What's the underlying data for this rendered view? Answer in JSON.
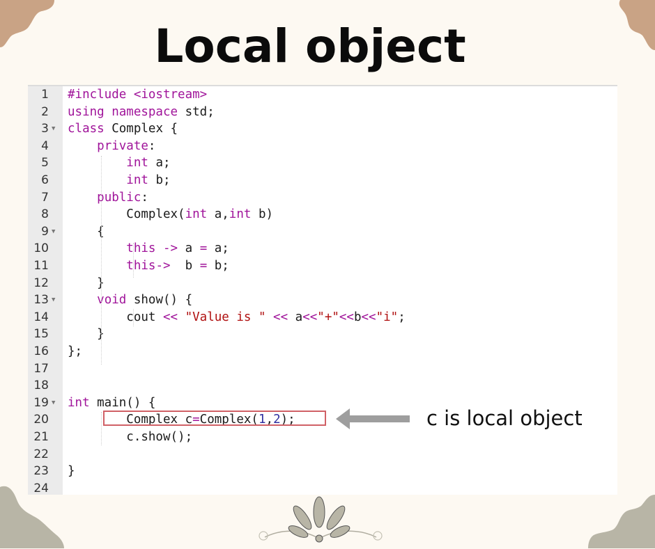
{
  "title": "Local object",
  "colors": {
    "background": "#fdf9f2",
    "corner_top": "#c9a385",
    "corner_bottom": "#b8b5a6",
    "keyword": "#a0149a",
    "string": "#b01010",
    "number": "#3030a0",
    "highlight_border": "#d06066",
    "arrow": "#9e9e9e"
  },
  "editor": {
    "lines": [
      {
        "num": "1",
        "fold": false
      },
      {
        "num": "2",
        "fold": false
      },
      {
        "num": "3",
        "fold": true
      },
      {
        "num": "4",
        "fold": false
      },
      {
        "num": "5",
        "fold": false
      },
      {
        "num": "6",
        "fold": false
      },
      {
        "num": "7",
        "fold": false
      },
      {
        "num": "8",
        "fold": false
      },
      {
        "num": "9",
        "fold": true
      },
      {
        "num": "10",
        "fold": false
      },
      {
        "num": "11",
        "fold": false
      },
      {
        "num": "12",
        "fold": false
      },
      {
        "num": "13",
        "fold": true
      },
      {
        "num": "14",
        "fold": false
      },
      {
        "num": "15",
        "fold": false
      },
      {
        "num": "16",
        "fold": false
      },
      {
        "num": "17",
        "fold": false
      },
      {
        "num": "18",
        "fold": false
      },
      {
        "num": "19",
        "fold": true
      },
      {
        "num": "20",
        "fold": false
      },
      {
        "num": "21",
        "fold": false
      },
      {
        "num": "22",
        "fold": false
      },
      {
        "num": "23",
        "fold": false
      },
      {
        "num": "24",
        "fold": false
      }
    ],
    "code": [
      [
        [
          "kw",
          "#include <iostream>"
        ]
      ],
      [
        [
          "kw",
          "using namespace"
        ],
        [
          "t",
          " std;"
        ]
      ],
      [
        [
          "kw",
          "class"
        ],
        [
          "t",
          " Complex {"
        ]
      ],
      [
        [
          "t",
          "    "
        ],
        [
          "kw",
          "private"
        ],
        [
          "t",
          ":"
        ]
      ],
      [
        [
          "t",
          "        "
        ],
        [
          "kw",
          "int"
        ],
        [
          "t",
          " a;"
        ]
      ],
      [
        [
          "t",
          "        "
        ],
        [
          "kw",
          "int"
        ],
        [
          "t",
          " b;"
        ]
      ],
      [
        [
          "t",
          "    "
        ],
        [
          "kw",
          "public"
        ],
        [
          "t",
          ":"
        ]
      ],
      [
        [
          "t",
          "        Complex("
        ],
        [
          "kw",
          "int"
        ],
        [
          "t",
          " a,"
        ],
        [
          "kw",
          "int"
        ],
        [
          "t",
          " b)"
        ]
      ],
      [
        [
          "t",
          "    {"
        ]
      ],
      [
        [
          "t",
          "        "
        ],
        [
          "kw",
          "this"
        ],
        [
          "t",
          " "
        ],
        [
          "op",
          "->"
        ],
        [
          "t",
          " a "
        ],
        [
          "op",
          "="
        ],
        [
          "t",
          " a;"
        ]
      ],
      [
        [
          "t",
          "        "
        ],
        [
          "kw",
          "this"
        ],
        [
          "op",
          "->"
        ],
        [
          "t",
          "  b "
        ],
        [
          "op",
          "="
        ],
        [
          "t",
          " b;"
        ]
      ],
      [
        [
          "t",
          "    }"
        ]
      ],
      [
        [
          "t",
          "    "
        ],
        [
          "kw",
          "void"
        ],
        [
          "t",
          " show() {"
        ]
      ],
      [
        [
          "t",
          "        cout "
        ],
        [
          "op",
          "<<"
        ],
        [
          "t",
          " "
        ],
        [
          "str",
          "\"Value is \""
        ],
        [
          "t",
          " "
        ],
        [
          "op",
          "<<"
        ],
        [
          "t",
          " a"
        ],
        [
          "op",
          "<<"
        ],
        [
          "str",
          "\"+\""
        ],
        [
          "op",
          "<<"
        ],
        [
          "t",
          "b"
        ],
        [
          "op",
          "<<"
        ],
        [
          "str",
          "\"i\""
        ],
        [
          "t",
          ";"
        ]
      ],
      [
        [
          "t",
          "    }"
        ]
      ],
      [
        [
          "t",
          "};"
        ]
      ],
      [
        [
          "t",
          ""
        ]
      ],
      [
        [
          "t",
          ""
        ]
      ],
      [
        [
          "kw",
          "int"
        ],
        [
          "t",
          " main() {"
        ]
      ],
      [
        [
          "t",
          "        Complex c"
        ],
        [
          "op",
          "="
        ],
        [
          "t",
          "Complex("
        ],
        [
          "num",
          "1"
        ],
        [
          "t",
          ","
        ],
        [
          "num",
          "2"
        ],
        [
          "t",
          ");"
        ]
      ],
      [
        [
          "t",
          "        c.show();"
        ]
      ],
      [
        [
          "t",
          ""
        ]
      ],
      [
        [
          "t",
          "}"
        ]
      ],
      [
        [
          "t",
          ""
        ]
      ]
    ]
  },
  "annotation": {
    "label": "c is local object",
    "highlighted_line": "20",
    "arrow_icon": "left-arrow"
  },
  "decor": {
    "ornament_icon": "fan-flourish",
    "corners": [
      "top-left-blob",
      "top-right-blob",
      "bottom-left-blob",
      "bottom-right-blob"
    ]
  }
}
